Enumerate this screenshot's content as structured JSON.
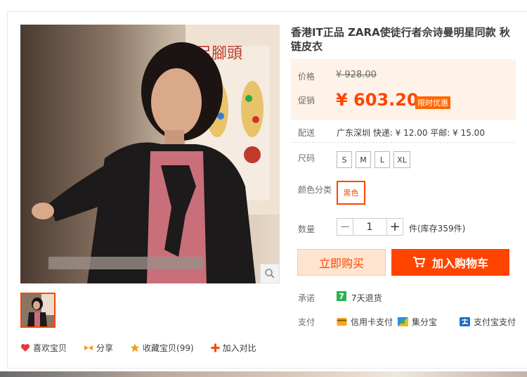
{
  "product": {
    "title": "香港IT正品 ZARA使徒行者佘诗曼明星同款 秋链皮衣"
  },
  "price": {
    "original_label": "价格",
    "original_value": "¥ 928.00",
    "promo_label": "促销",
    "promo_value": "¥ 603.20",
    "promo_tag": "限时优惠"
  },
  "shipping": {
    "label": "配送",
    "text": "广东深圳 快递: ¥ 12.00   平邮: ¥ 15.00"
  },
  "size": {
    "label": "尺码",
    "options": [
      "S",
      "M",
      "L",
      "XL"
    ]
  },
  "color": {
    "label": "颜色分类",
    "selected": "黑色"
  },
  "quantity": {
    "label": "数量",
    "minus": "−",
    "value": "1",
    "plus": "+",
    "stock": "件(库存359件)"
  },
  "actions": {
    "buy_now": "立即购买",
    "add_to_cart": "加入购物车"
  },
  "promise": {
    "label": "承诺",
    "icon_text": "7",
    "text": "7天退货"
  },
  "payment": {
    "label": "支付",
    "methods": [
      "信用卡支付",
      "集分宝",
      "支付宝支付"
    ]
  },
  "social": {
    "like": "喜欢宝贝",
    "share": "分享",
    "favorite": "收藏宝贝(99)",
    "compare": "加入对比"
  },
  "photo_sign": {
    "line1": "足腳頭"
  },
  "colors": {
    "accent": "#ff4400",
    "price_bg": "#fff2e8",
    "buy_bg": "#ffe4d0"
  }
}
